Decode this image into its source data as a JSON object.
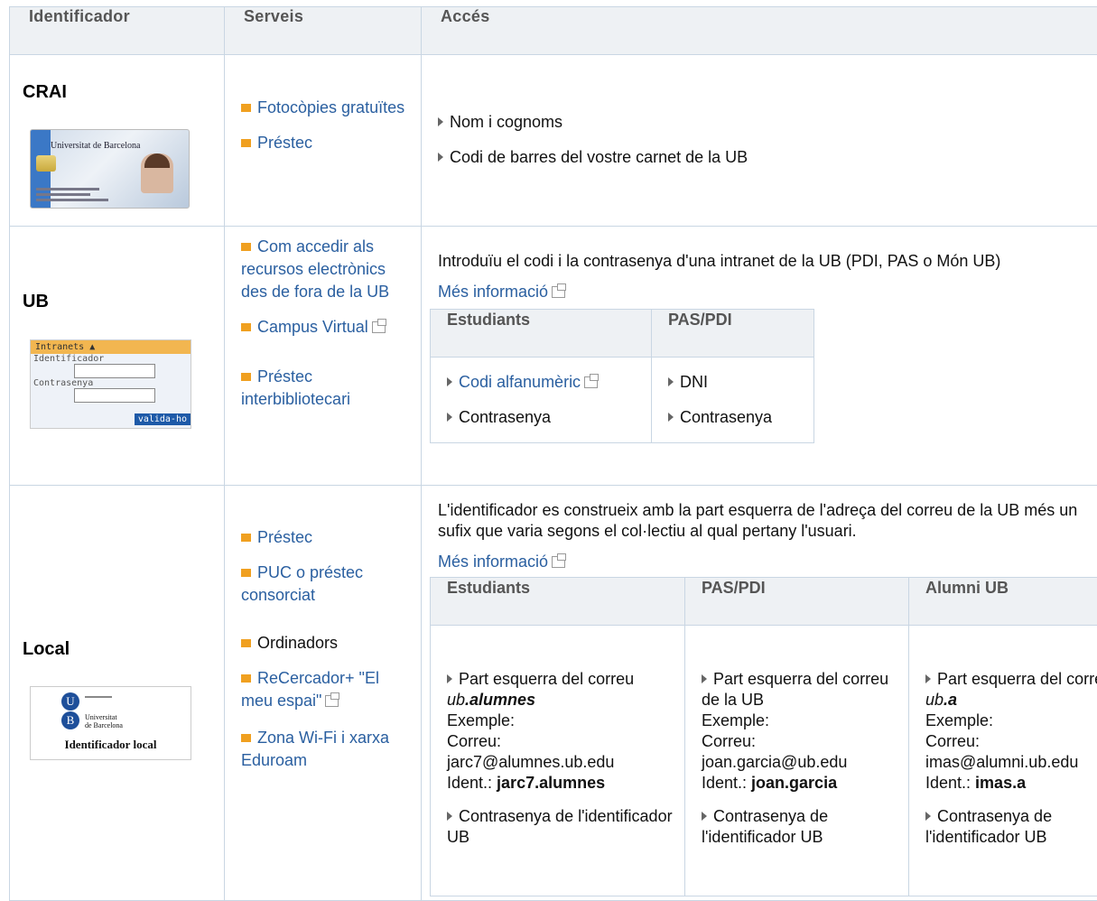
{
  "headers": {
    "identificador": "Identificador",
    "serveis": "Serveis",
    "acces": "Accés"
  },
  "crai": {
    "name": "CRAI",
    "card_text": "Universitat de Barcelona",
    "services": [
      "Fotocòpies gratuïtes",
      "Préstec"
    ],
    "access": [
      "Nom i cognoms",
      "Codi de barres del vostre carnet de la UB"
    ]
  },
  "ub": {
    "name": "UB",
    "login_box": {
      "title": "Intranets",
      "field1": "Identificador",
      "field2": "Contrasenya",
      "button": "valida-ho"
    },
    "services": [
      "Com accedir als recursos electrònics des de fora de la UB",
      "Campus Virtual",
      "Préstec interbibliotecari"
    ],
    "intro": "Introduïu el codi i la contrasenya d'una intranet de la UB (PDI, PAS o Món UB)",
    "more_info": "Més informació",
    "table": {
      "col1": "Estudiants",
      "col2": "PAS/PDI",
      "col1_items": [
        "Codi alfanumèric",
        "Contrasenya"
      ],
      "col2_items": [
        "DNI",
        "Contrasenya"
      ]
    }
  },
  "local": {
    "name": "Local",
    "logo": {
      "line1": "Universitat",
      "line2": "de Barcelona",
      "caption": "Identificador local"
    },
    "services": [
      "Préstec",
      "PUC o préstec consorciat",
      "Ordinadors",
      "ReCercador+ \"El meu espai\"",
      "Zona Wi-Fi i xarxa Eduroam"
    ],
    "intro": "L'identificador es construeix amb la part esquerra de l'adreça del correu de la UB més un sufix que varia segons el col·lectiu al qual pertany l'usuari.",
    "more_info": "Més informació",
    "table": {
      "cols": [
        "Estudiants",
        "PAS/PDI",
        "Alumni UB"
      ],
      "estudiants": {
        "p1": "Part esquerra del correu ",
        "p1_it": "ub",
        "p1_b": ".alumnes",
        "ex": "Exemple:",
        "correu_label": "Correu:",
        "correu": "jarc7@alumnes.ub.edu",
        "ident_label": "Ident.: ",
        "ident": "jarc7.alumnes",
        "pw": "Contrasenya de l'identificador UB"
      },
      "pas": {
        "p1": "Part esquerra del correu de la UB",
        "ex": "Exemple:",
        "correu_label": "Correu:",
        "correu": "joan.garcia@ub.edu",
        "ident_label": "Ident.: ",
        "ident": "joan.garcia",
        "pw": "Contrasenya de l'identificador UB"
      },
      "alumni": {
        "p1": "Part esquerra del correu ",
        "p1_it": "ub",
        "p1_b": ".a",
        "ex": "Exemple:",
        "correu_label": "Correu:",
        "correu": "imas@alumni.ub.edu",
        "ident_label": "Ident.: ",
        "ident": "imas.a",
        "pw": "Contrasenya de l'identificador UB"
      }
    }
  }
}
